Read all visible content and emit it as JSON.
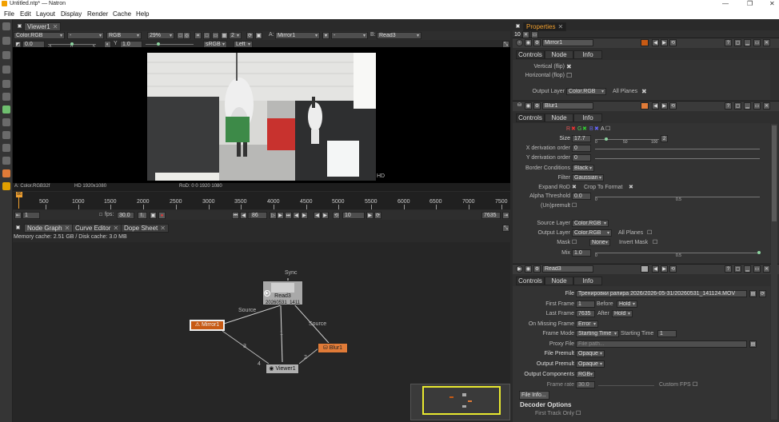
{
  "window": {
    "title": "Untitled.ntp* — Natron",
    "min": "—",
    "max": "❐",
    "close": "✕"
  },
  "menu": [
    "File",
    "Edit",
    "Layout",
    "Display",
    "Render",
    "Cache",
    "Help"
  ],
  "viewer": {
    "tab": "Viewer1",
    "layer": "Color.RGB",
    "alpha": "-",
    "channels": "RGB",
    "zoom": "29%",
    "frame_count": "2",
    "input_a_label": "A:",
    "input_a": "Mirror1",
    "wipe": "-",
    "input_b_label": "B:",
    "input_b": "Read3",
    "gain": "0.0",
    "gain_ticks": [
      "-5",
      "0",
      "5"
    ],
    "gamma_label": "Y",
    "gamma": "1.0",
    "colorspace": "sRGB",
    "side": "Left",
    "hd_label": "HD",
    "info_left": "A: Color.RGB32f",
    "info_mid": "HD 1920x1080",
    "info_rod": "RoD: 0 0 1920 1080"
  },
  "timeline": {
    "marks": [
      "500",
      "1000",
      "1500",
      "2000",
      "2500",
      "3000",
      "3500",
      "4000",
      "4500",
      "5000",
      "5500",
      "6000",
      "6500",
      "7000",
      "7500"
    ],
    "cursor_label": "86",
    "start": "1",
    "fps_label": "fps:",
    "fps": "30.0",
    "current": "86",
    "step": "10",
    "end": "7635"
  },
  "nodegraph": {
    "tabs": [
      {
        "label": "Node Graph"
      },
      {
        "label": "Curve Editor"
      },
      {
        "label": "Dope Sheet"
      }
    ],
    "memory": "Memory cache: 2.51 GB / Disk cache: 3.0 MB",
    "nodes": {
      "read": "Read3",
      "read_sub": "20260531_1411",
      "mirror": "Mirror1",
      "blur": "Blur1",
      "viewer": "Viewer1"
    },
    "edge_labels": {
      "sync": "Sync",
      "source_left": "Source",
      "source_right": "Source",
      "e1": "1",
      "e2": "2",
      "e3": "3",
      "e4": "4"
    },
    "colors": {
      "mirror": "#c75a14",
      "blur": "#e07b38",
      "read": "#a9a9a9",
      "viewer": "#b0b0b0",
      "minimap_border": "#e8e830"
    }
  },
  "properties": {
    "tab": "Properties",
    "max_nodes": "10",
    "mirror": {
      "name": "Mirror1",
      "tabs": [
        "Controls",
        "Node",
        "Info"
      ],
      "vertical": "Vertical (flip)",
      "horizontal": "Horizontal (flop)",
      "output_layer_label": "Output Layer",
      "output_layer": "Color.RGB",
      "all_planes": "All Planes"
    },
    "blur": {
      "name": "Blur1",
      "tabs": [
        "Controls",
        "Node",
        "Info"
      ],
      "rgba": [
        "R",
        "G",
        "B",
        "A"
      ],
      "size_label": "Size",
      "size": "17.7",
      "size_ticks": [
        "0",
        "50",
        "100"
      ],
      "size2": "2",
      "xderiv_label": "X derivation order",
      "xderiv": "0",
      "yderiv_label": "Y derivation order",
      "yderiv": "0",
      "border_label": "Border Conditions",
      "border": "Black",
      "filter_label": "Filter",
      "filter": "Gaussian",
      "expand": "Expand RoD",
      "crop": "Crop To Format",
      "alpha_label": "Alpha Threshold",
      "alpha": "0.0",
      "alpha_ticks": [
        "0",
        "0.5"
      ],
      "unpremult": "(Un)premult",
      "source_layer_label": "Source Layer",
      "source_layer": "Color.RGB",
      "output_layer_label": "Output Layer",
      "output_layer": "Color.RGB",
      "all_planes": "All Planes",
      "mask_label": "Mask",
      "mask": "None",
      "invert_mask": "Invert Mask",
      "mix_label": "Mix",
      "mix": "1.0",
      "mix_ticks": [
        "0",
        "0.5"
      ]
    },
    "read": {
      "name": "Read3",
      "tabs": [
        "Controls",
        "Node",
        "Info"
      ],
      "file_label": "File",
      "file": "Тренировки рапира 2026/2026-05-31/20260531_141124.MOV",
      "first_label": "First Frame",
      "first": "1",
      "before_label": "Before",
      "before": "Hold",
      "last_label": "Last Frame",
      "last": "7635",
      "after_label": "After",
      "after": "Hold",
      "missing_label": "On Missing Frame",
      "missing": "Error",
      "frame_mode_label": "Frame Mode",
      "frame_mode": "Starting Time",
      "starting_time_label": "Starting Time",
      "starting_time": "1",
      "proxy_label": "Proxy File",
      "proxy_placeholder": "File path...",
      "file_premult_label": "File Premult",
      "file_premult": "Opaque",
      "output_premult_label": "Output Premult",
      "output_premult": "Opaque",
      "output_comp_label": "Output Components",
      "output_comp": "RGB",
      "frame_rate_label": "Frame rate",
      "frame_rate": "30.0",
      "custom_fps": "Custom FPS",
      "file_info": "File Info...",
      "decoder": "Decoder Options",
      "first_track": "First Track Only"
    }
  }
}
